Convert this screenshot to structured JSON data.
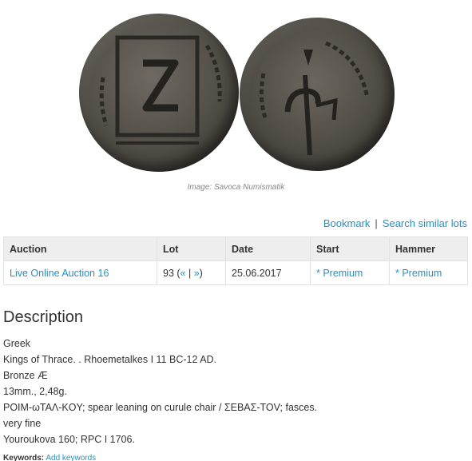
{
  "image": {
    "caption": "Image: Savoca Numismatik"
  },
  "actions": {
    "bookmark": "Bookmark",
    "separator": "|",
    "search_similar": "Search similar lots"
  },
  "table": {
    "headers": [
      "Auction",
      "Lot",
      "Date",
      "Start",
      "Hammer"
    ],
    "row": {
      "auction": "Live Online Auction 16",
      "lot_number": "93 (",
      "lot_prev": "«",
      "lot_mid": " | ",
      "lot_next": "»",
      "lot_close": ")",
      "date": "25.06.2017",
      "start": "* Premium",
      "hammer": "* Premium"
    }
  },
  "description": {
    "title": "Description",
    "lines": [
      "Greek",
      "Kings of Thrace. . Rhoemetalkes I 11 BC-12 AD.",
      "Bronze Æ",
      "13mm., 2,48g.",
      "POIM-ωTAΛ-KOY; spear leaning on curule chair / ΣEBAΣ-TOV; fasces.",
      "very fine",
      "Youroukova 160; RPC I 1706."
    ]
  },
  "keywords": {
    "label": "Keywords:",
    "add": "Add keywords"
  }
}
